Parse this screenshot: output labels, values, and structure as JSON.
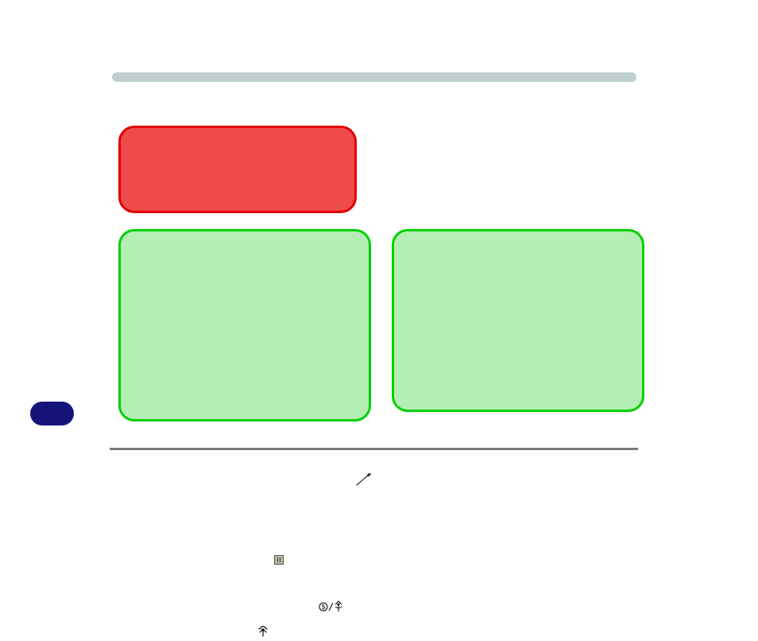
{
  "colors": {
    "top_bar": "#bdcfce",
    "red_box_fill": "#ef4b4b",
    "red_box_border": "#e20000",
    "green_box_fill": "#b4eeb4",
    "green_box_border": "#00d000",
    "pill": "#14147a",
    "hr": "#7a7a7a"
  },
  "icons": {
    "bell": "bell-icon",
    "needle_left": "needle-icon",
    "needle_right": "needle-icon",
    "square": "panel-icon",
    "dollar_antenna": "dollar-antenna-icon",
    "antenna": "antenna-icon"
  }
}
